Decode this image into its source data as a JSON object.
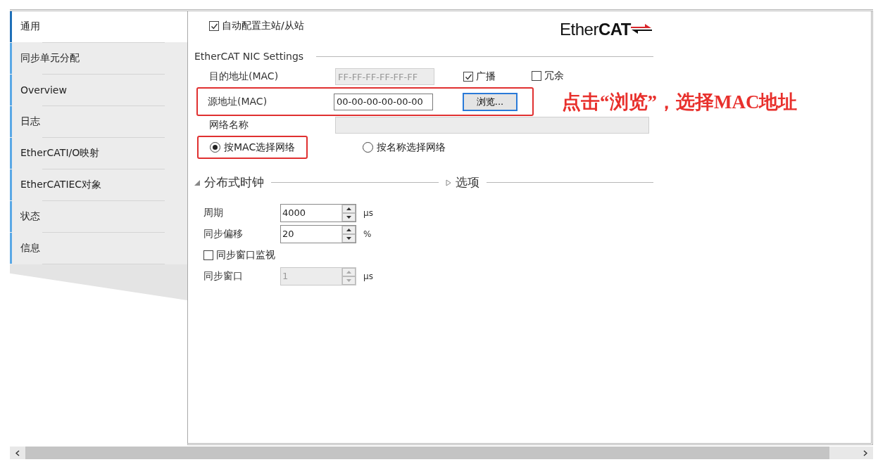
{
  "sidebar": {
    "items": [
      {
        "label": "通用",
        "selected": true
      },
      {
        "label": "同步单元分配",
        "selected": false
      },
      {
        "label": "Overview",
        "selected": false
      },
      {
        "label": "日志",
        "selected": false
      },
      {
        "label": "EtherCATI/O映射",
        "selected": false
      },
      {
        "label": "EtherCATIEC对象",
        "selected": false
      },
      {
        "label": "状态",
        "selected": false
      },
      {
        "label": "信息",
        "selected": false
      }
    ]
  },
  "auto_config": {
    "label": "自动配置主站/从站",
    "checked": true
  },
  "logo": {
    "text": "Ether**CAT**"
  },
  "nic_settings": {
    "title": "EtherCAT NIC Settings",
    "destination": {
      "label": "目的地址(MAC)",
      "value": "FF-FF-FF-FF-FF-FF",
      "disabled": true,
      "broadcast": {
        "label": "广播",
        "checked": true
      },
      "redundancy": {
        "label": "冗余",
        "checked": false
      }
    },
    "source": {
      "label": "源地址(MAC)",
      "value": "00-00-00-00-00-00",
      "highlighted": true,
      "browse_button": "浏览...",
      "button_focused": true
    },
    "network_name": {
      "label": "网络名称",
      "disabled": true
    },
    "select_by": [
      {
        "label": "按MAC选择网络",
        "selected": true,
        "highlighted": true
      },
      {
        "label": "按名称选择网络",
        "selected": false,
        "highlighted": false
      }
    ]
  },
  "annotation": "点击“浏览”，选择MAC地址",
  "distributed_clock": {
    "title": "分布式时钟",
    "expanded": true,
    "fields": [
      {
        "kind": "spin",
        "label": "周期",
        "value": "4000",
        "unit": "µs",
        "disabled": false
      },
      {
        "kind": "spin",
        "label": "同步偏移",
        "value": "20",
        "unit": "%",
        "disabled": false
      },
      {
        "kind": "check",
        "label": "同步窗口监视",
        "checked": false
      },
      {
        "kind": "spin",
        "label": "同步窗口",
        "value": "1",
        "unit": "µs",
        "disabled": true
      }
    ]
  },
  "options": {
    "title": "选项",
    "expanded": false
  }
}
